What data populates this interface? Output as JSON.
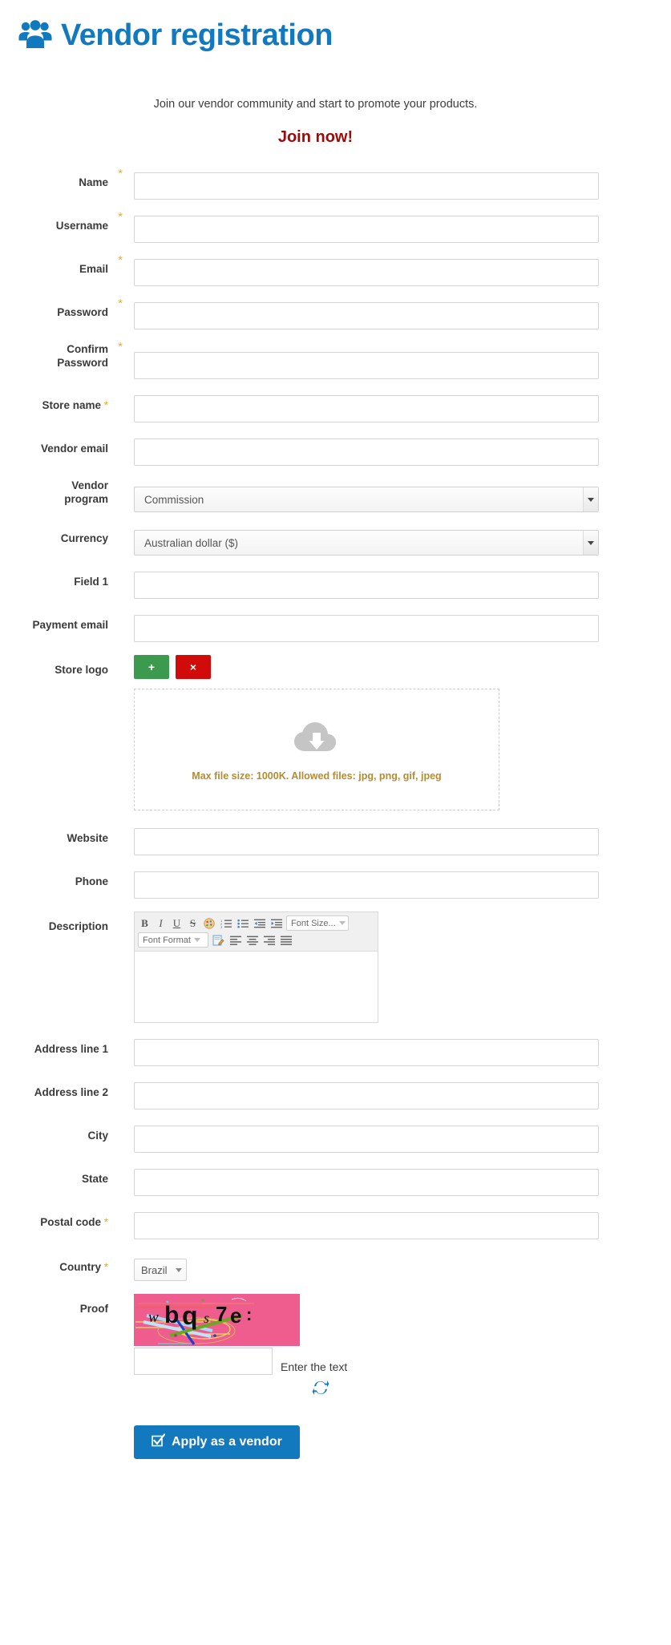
{
  "header": {
    "icon": "users-group-icon",
    "title": "Vendor registration",
    "brand_color": "#1279bf"
  },
  "intro": {
    "tagline": "Join our vendor community and start to promote your products.",
    "cta": "Join now!",
    "cta_color": "#9c0a0a"
  },
  "form": {
    "required_marker": "*",
    "required_color": "#f0ad21",
    "fields": [
      {
        "label": "Name",
        "required": true,
        "marker": "sup",
        "type": "text",
        "value": ""
      },
      {
        "label": "Username",
        "required": true,
        "marker": "sup",
        "type": "text",
        "value": ""
      },
      {
        "label": "Email",
        "required": true,
        "marker": "sup",
        "type": "text",
        "value": ""
      },
      {
        "label": "Password",
        "required": true,
        "marker": "sup",
        "type": "text",
        "value": ""
      },
      {
        "label": "Confirm Password",
        "required": true,
        "marker": "sup",
        "type": "text",
        "value": ""
      },
      {
        "label": "Store name",
        "required": true,
        "marker": "inline",
        "type": "text",
        "value": ""
      },
      {
        "label": "Vendor email",
        "required": false,
        "type": "text",
        "value": ""
      },
      {
        "label": "Vendor program",
        "required": false,
        "type": "select",
        "value": "Commission"
      },
      {
        "label": "Currency",
        "required": false,
        "type": "select",
        "value": "Australian dollar ($)"
      },
      {
        "label": "Field 1",
        "required": false,
        "type": "text",
        "value": ""
      },
      {
        "label": "Payment email",
        "required": false,
        "type": "text",
        "value": ""
      },
      {
        "label": "Store logo",
        "required": false,
        "type": "upload"
      },
      {
        "label": "Website",
        "required": false,
        "type": "text",
        "value": ""
      },
      {
        "label": "Phone",
        "required": false,
        "type": "text",
        "value": ""
      },
      {
        "label": "Description",
        "required": false,
        "type": "editor",
        "value": ""
      },
      {
        "label": "Address line 1",
        "required": false,
        "type": "text",
        "value": ""
      },
      {
        "label": "Address line 2",
        "required": false,
        "type": "text",
        "value": ""
      },
      {
        "label": "City",
        "required": false,
        "type": "text",
        "value": ""
      },
      {
        "label": "State",
        "required": false,
        "type": "text",
        "value": ""
      },
      {
        "label": "Postal code",
        "required": true,
        "marker": "inline",
        "type": "text",
        "value": ""
      },
      {
        "label": "Country",
        "required": true,
        "marker": "inline",
        "type": "select-small",
        "value": "Brazil"
      },
      {
        "label": "Proof",
        "required": false,
        "type": "captcha"
      }
    ]
  },
  "labels": {
    "name": "Name",
    "username": "Username",
    "email": "Email",
    "password": "Password",
    "confirm_password_l1": "Confirm",
    "confirm_password_l2": "Password",
    "store_name": "Store name",
    "vendor_email": "Vendor email",
    "vendor_program_l1": "Vendor",
    "vendor_program_l2": "program",
    "currency": "Currency",
    "field_1": "Field 1",
    "payment_email": "Payment email",
    "store_logo": "Store logo",
    "website": "Website",
    "phone": "Phone",
    "description": "Description",
    "address_line_1": "Address line 1",
    "address_line_2": "Address line 2",
    "city": "City",
    "state": "State",
    "postal_code": "Postal code",
    "country": "Country",
    "proof": "Proof"
  },
  "values": {
    "vendor_program": "Commission",
    "currency": "Australian dollar ($)",
    "country": "Brazil"
  },
  "store_logo": {
    "add_button": "+",
    "add_color": "#3c9a4e",
    "delete_button": "×",
    "delete_color": "#d10a0a",
    "dropzone_icon": "cloud-download-icon",
    "dropzone_hint": "Max file size: 1000K. Allowed files: jpg, png, gif, jpeg",
    "hint_color": "#b58b2e"
  },
  "editor": {
    "toolbar_row1": [
      {
        "name": "bold-icon",
        "glyph": "B",
        "style": "bold-serif"
      },
      {
        "name": "italic-icon",
        "glyph": "I",
        "style": "italic-serif"
      },
      {
        "name": "underline-icon",
        "glyph": "U",
        "style": "underline-serif"
      },
      {
        "name": "strikethrough-icon",
        "glyph": "S",
        "style": "strike-serif"
      },
      {
        "name": "text-color-palette-icon",
        "glyph": "palette"
      },
      {
        "name": "numbered-list-icon",
        "glyph": "ol"
      },
      {
        "name": "bulleted-list-icon",
        "glyph": "ul"
      },
      {
        "name": "outdent-icon",
        "glyph": "outdent"
      },
      {
        "name": "indent-icon",
        "glyph": "indent"
      }
    ],
    "font_size_label": "Font Size...",
    "font_format_label": "Font Format",
    "toolbar_row2": [
      {
        "name": "source-edit-icon",
        "glyph": "edit"
      },
      {
        "name": "align-left-icon",
        "glyph": "align-left"
      },
      {
        "name": "align-center-icon",
        "glyph": "align-center"
      },
      {
        "name": "align-right-icon",
        "glyph": "align-right"
      },
      {
        "name": "align-justify-icon",
        "glyph": "align-justify"
      }
    ],
    "body_value": ""
  },
  "captcha": {
    "image_text": "wbqs7e",
    "background_color": "#ef5c8e",
    "enter_text_label": "Enter the text",
    "input_value": "",
    "refresh_icon": "refresh-icon",
    "refresh_color": "#1279bf"
  },
  "submit": {
    "icon": "checkbox-checked-icon",
    "label": "Apply as a vendor",
    "color": "#1279bf"
  }
}
